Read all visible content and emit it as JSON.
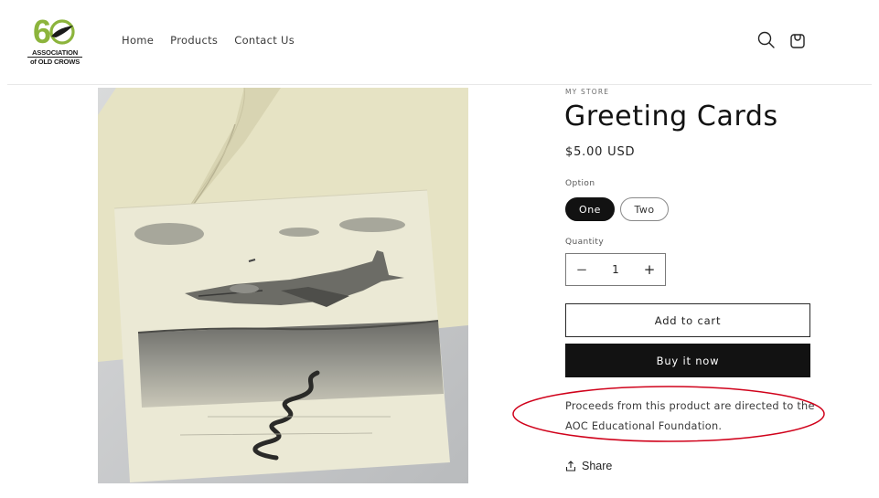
{
  "header": {
    "logo": {
      "number": "60",
      "line1": "ASSOCIATION",
      "line2": "of OLD CROWS"
    },
    "nav": [
      {
        "label": "Home"
      },
      {
        "label": "Products"
      },
      {
        "label": "Contact Us"
      }
    ],
    "icons": {
      "search": "search-icon",
      "cart": "cart-icon"
    }
  },
  "product": {
    "vendor": "MY STORE",
    "title": "Greeting Cards",
    "price": "$5.00 USD",
    "option_label": "Option",
    "options": [
      {
        "label": "One",
        "selected": true
      },
      {
        "label": "Two",
        "selected": false
      }
    ],
    "quantity_label": "Quantity",
    "quantity": "1",
    "quantity_minus": "−",
    "quantity_plus": "+",
    "add_to_cart": "Add to cart",
    "buy_now": "Buy it now",
    "description": "Proceeds from this product are directed to the AOC Educational Foundation.",
    "share": "Share"
  },
  "colors": {
    "primary": "#121212",
    "annotation": "#d0021b",
    "logo_green": "#8cb43c"
  }
}
